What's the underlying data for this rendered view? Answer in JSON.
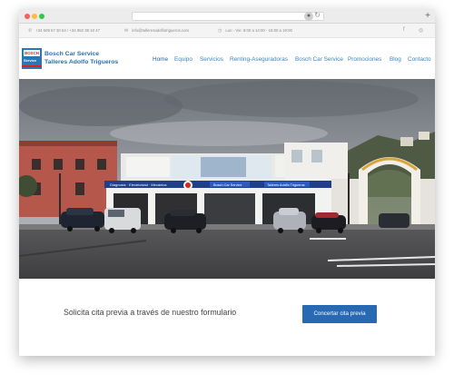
{
  "topbar": {
    "phone": "+34 609 67 30 54 / +34 952 39 10 47",
    "email": "info@talleresadolfotrigueros.com",
    "hours": "Lun - Vie: 9:00 a 14:00 - 16:00 a 19:00",
    "social": [
      {
        "name": "facebook-icon",
        "glyph": "f"
      },
      {
        "name": "instagram-icon",
        "glyph": "◎"
      }
    ]
  },
  "logo": {
    "top": "BOSCH",
    "bottom": "Service"
  },
  "brand": {
    "line1": "Bosch Car Service",
    "line2": "Talleres Adolfo Trigueros"
  },
  "nav": {
    "items": [
      {
        "label": "Home",
        "name": "nav-home",
        "active": true
      },
      {
        "label": "Equipo",
        "name": "nav-equipo"
      },
      {
        "label": "Servicios",
        "name": "nav-servicios"
      },
      {
        "label": "Renting-Aseguradoras",
        "name": "nav-renting-aseguradoras"
      },
      {
        "label": "Bosch Car Service",
        "name": "nav-bosch-car-service"
      },
      {
        "label": "Promociones",
        "name": "nav-promociones"
      },
      {
        "label": "Blog",
        "name": "nav-blog"
      },
      {
        "label": "Contacto",
        "name": "nav-contacto"
      }
    ]
  },
  "hero": {
    "sign_left": "Diagnosis · Electricidad · Mecánica",
    "sign_center": "Bosch Car Service",
    "sign_right": "Talleres Adolfo Trigueros"
  },
  "cta": {
    "text": "Solicita cita previa a través de nuestro formulario",
    "button": "Concertar cita previa"
  },
  "colors": {
    "brand_blue": "#2a6fae",
    "button_blue": "#2769b3",
    "nav_blue": "#3a86c7",
    "bosch_red": "#d9241b"
  }
}
